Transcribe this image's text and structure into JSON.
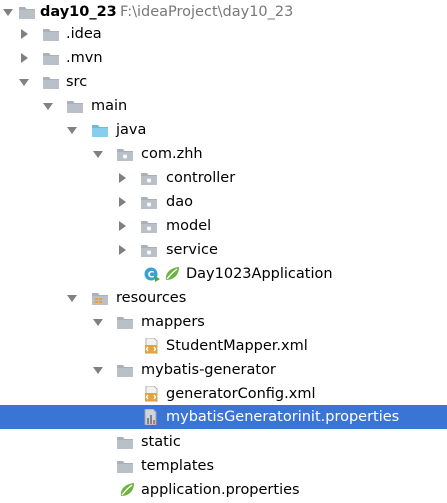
{
  "project": {
    "name": "day10_23",
    "path": "F:\\ideaProject\\day10_23"
  },
  "tree": {
    "idea": ".idea",
    "mvn": ".mvn",
    "src": "src",
    "main": "main",
    "java": "java",
    "com_zhh": "com.zhh",
    "controller": "controller",
    "dao": "dao",
    "model": "model",
    "service": "service",
    "application_class": "Day1023Application",
    "resources": "resources",
    "mappers": "mappers",
    "student_mapper": "StudentMapper.xml",
    "mybatis_generator": "mybatis-generator",
    "generator_config": "generatorConfig.xml",
    "generator_props": "mybatisGeneratorinit.properties",
    "static": "static",
    "templates": "templates",
    "application_props": "application.properties"
  },
  "colors": {
    "selection": "#3a75d6",
    "folder": "#a9b1ba",
    "source_folder": "#7fc5e8",
    "xml_orange": "#e6a23c",
    "spring_green": "#6db33f"
  },
  "icons": {
    "folder": "folder-icon",
    "source_root": "source-folder-icon",
    "package": "package-icon",
    "resources": "resources-folder-icon",
    "xml": "xml-file-icon",
    "properties": "properties-file-icon",
    "spring": "spring-boot-icon"
  }
}
